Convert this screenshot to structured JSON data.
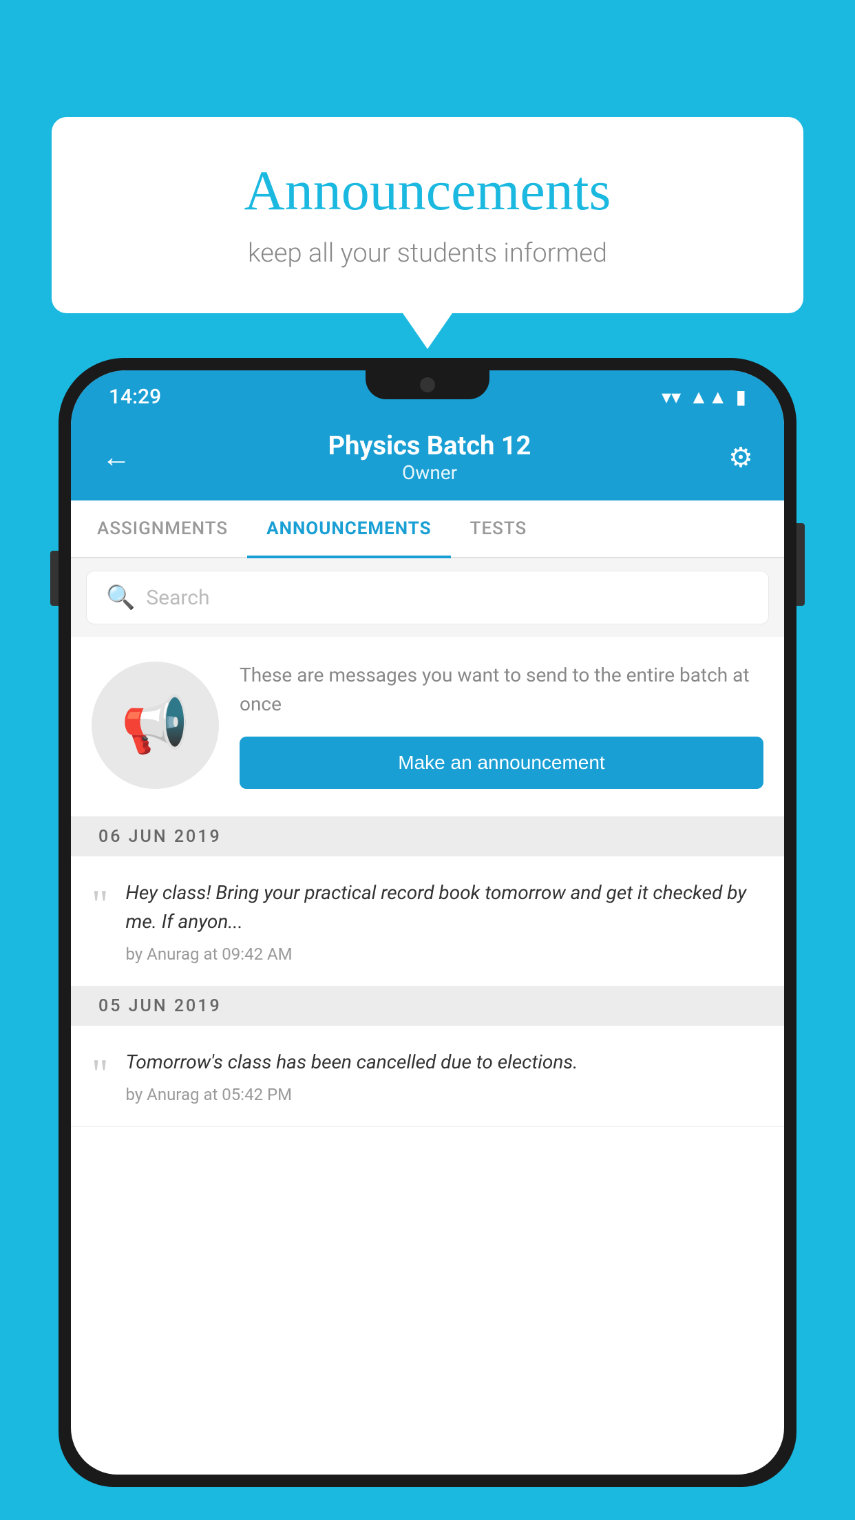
{
  "background_color": "#1bb8e0",
  "speech_bubble": {
    "title": "Announcements",
    "subtitle": "keep all your students informed"
  },
  "phone": {
    "status_bar": {
      "time": "14:29",
      "icons": [
        "wifi",
        "signal",
        "battery"
      ]
    },
    "header": {
      "title": "Physics Batch 12",
      "subtitle": "Owner",
      "back_label": "←",
      "settings_label": "⚙"
    },
    "tabs": [
      {
        "label": "ASSIGNMENTS",
        "active": false
      },
      {
        "label": "ANNOUNCEMENTS",
        "active": true
      },
      {
        "label": "TESTS",
        "active": false
      }
    ],
    "search": {
      "placeholder": "Search"
    },
    "promo": {
      "description": "These are messages you want to send to the entire batch at once",
      "button_label": "Make an announcement"
    },
    "announcements": [
      {
        "date": "06  JUN  2019",
        "text": "Hey class! Bring your practical record book tomorrow and get it checked by me. If anyon...",
        "meta": "by Anurag at 09:42 AM"
      },
      {
        "date": "05  JUN  2019",
        "text": "Tomorrow's class has been cancelled due to elections.",
        "meta": "by Anurag at 05:42 PM"
      }
    ]
  }
}
